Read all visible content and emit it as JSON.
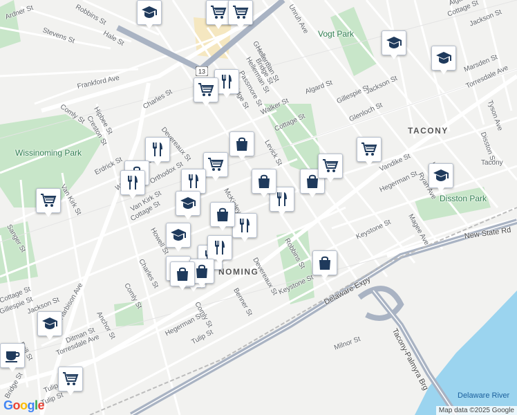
{
  "map": {
    "attribution": "Map data ©2025 Google",
    "logo": "Google",
    "route_shield": "13",
    "neighborhoods": [
      "TACONY",
      "NOMING"
    ],
    "parks": [
      "Vogt Park",
      "Wissinoming Park",
      "Disston Park"
    ],
    "water": [
      "Delaware River"
    ],
    "highways": [
      "New State Rd",
      "Delaware Expy",
      "Tacony-Palmyra Brg"
    ],
    "labels": [
      "Robbins St",
      "Ardner St",
      "Stevens St",
      "Hale St",
      "Frankford Ave",
      "Comly St",
      "Hipbee St",
      "Creston St",
      "Charles St",
      "Devereaux St",
      "Mayo St",
      "Orthodox St",
      "Cottage St",
      "Greeby St",
      "Hellerman St",
      "Passmore St",
      "Ridge St",
      "Walker St",
      "Algard St",
      "Gillespie St",
      "Jackson St",
      "Cottage St",
      "Marsden St",
      "Torresdale Ave",
      "Tyson Ave",
      "Glenloch St",
      "Disston St",
      "Levick St",
      "Tacony",
      "Vandike St",
      "Knorr St",
      "Ryan Ave",
      "Hegerman St",
      "Magee Ave",
      "Keystone St",
      "McKinley St",
      "Devereaux St",
      "Robbins St",
      "Benner St",
      "Keystone St",
      "Milnor St",
      "Sanger St",
      "Van Kirk St",
      "Erdrick St",
      "Walker St",
      "Charles St",
      "Howell St",
      "Comly St",
      "Van Kirk St",
      "Cottage St",
      "Gillespie St",
      "Jackson St",
      "Anchor St",
      "Ditman St",
      "Hegerman St",
      "Tulip St",
      "Comly St",
      "Torresdale Ave",
      "Harbison Ave",
      "Brill St",
      "Bridge St",
      "Tulip St",
      "Unruh Ave",
      "Algard St",
      "Cottage St",
      "Jackson St",
      "Hellerman St",
      "Bridge St",
      "Tulip St"
    ]
  },
  "pois": [
    {
      "type": "school",
      "name": "school-icon"
    },
    {
      "type": "grocery",
      "name": "grocery-cart-icon"
    },
    {
      "type": "grocery",
      "name": "grocery-cart-icon"
    },
    {
      "type": "school",
      "name": "school-icon"
    },
    {
      "type": "school",
      "name": "school-icon"
    },
    {
      "type": "restaurant",
      "name": "restaurant-icon"
    },
    {
      "type": "grocery",
      "name": "grocery-cart-icon"
    },
    {
      "type": "shopping",
      "name": "shopping-bag-icon"
    },
    {
      "type": "restaurant",
      "name": "restaurant-icon"
    },
    {
      "type": "grocery",
      "name": "grocery-cart-icon"
    },
    {
      "type": "grocery",
      "name": "grocery-cart-icon"
    },
    {
      "type": "shopping",
      "name": "shopping-bag-icon"
    },
    {
      "type": "restaurant",
      "name": "restaurant-icon"
    },
    {
      "type": "restaurant",
      "name": "restaurant-icon"
    },
    {
      "type": "restaurant",
      "name": "restaurant-icon"
    },
    {
      "type": "shopping",
      "name": "shopping-bag-icon"
    },
    {
      "type": "restaurant",
      "name": "restaurant-icon"
    },
    {
      "type": "grocery",
      "name": "grocery-cart-icon"
    },
    {
      "type": "shopping",
      "name": "shopping-bag-icon"
    },
    {
      "type": "school",
      "name": "school-icon"
    },
    {
      "type": "school",
      "name": "school-icon"
    },
    {
      "type": "shopping",
      "name": "shopping-bag-icon"
    },
    {
      "type": "restaurant",
      "name": "restaurant-icon"
    },
    {
      "type": "school",
      "name": "school-icon"
    },
    {
      "type": "restaurant",
      "name": "restaurant-icon"
    },
    {
      "type": "shopping",
      "name": "shopping-bag-icon"
    },
    {
      "type": "restaurant",
      "name": "restaurant-icon"
    },
    {
      "type": "shopping",
      "name": "shopping-bag-icon"
    },
    {
      "type": "shopping",
      "name": "shopping-bag-icon"
    },
    {
      "type": "shopping",
      "name": "shopping-bag-icon"
    },
    {
      "type": "grocery",
      "name": "grocery-cart-icon"
    },
    {
      "type": "school",
      "name": "school-icon"
    },
    {
      "type": "coffee",
      "name": "coffee-cup-icon"
    },
    {
      "type": "grocery",
      "name": "grocery-cart-icon"
    }
  ],
  "colors": {
    "pin_icon": "#1f3a5c",
    "park": "#c8e6c9",
    "water": "#9bd4ef",
    "highway": "#a9b3c3",
    "road": "#ffffff",
    "background": "#f2f2f0"
  }
}
